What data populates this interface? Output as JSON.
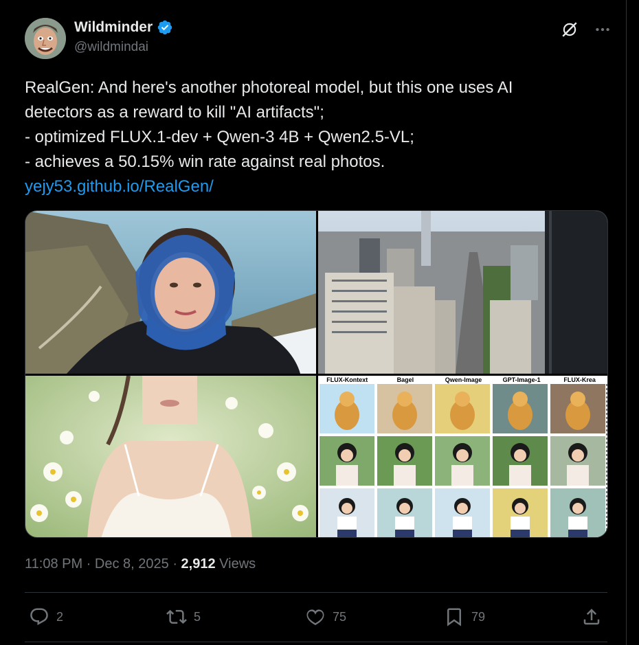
{
  "user": {
    "display_name": "Wildminder",
    "handle": "@wildmindai",
    "verified": true,
    "avatar_icon": "cartoon-avatar"
  },
  "top_icons": [
    "grok-icon",
    "more-icon"
  ],
  "tweet": {
    "lines": [
      "RealGen: And here's another photoreal model, but this one uses AI",
      "detectors as a reward to kill \"AI artifacts\";",
      "- optimized FLUX.1-dev + Qwen-3 4B + Qwen2.5-VL;",
      "- achieves a 50.15% win rate against real photos."
    ],
    "link": "yejy53.github.io/RealGen/"
  },
  "media": {
    "grid_headers": [
      "FLUX-Kontext",
      "Bagel",
      "Qwen-Image",
      "GPT-Image-1",
      "FLUX-Krea"
    ]
  },
  "meta": {
    "time": "11:08 PM",
    "sep1": " · ",
    "date": "Dec 8, 2025",
    "sep2": " · ",
    "views_count": "2,912",
    "views_label": " Views"
  },
  "actions": {
    "replies": "2",
    "reposts": "5",
    "likes": "75",
    "bookmarks": "79"
  },
  "colors": {
    "background": "#000000",
    "text": "#e7e9ea",
    "muted": "#71767b",
    "link": "#1d9bf0",
    "divider": "#2f3336"
  }
}
